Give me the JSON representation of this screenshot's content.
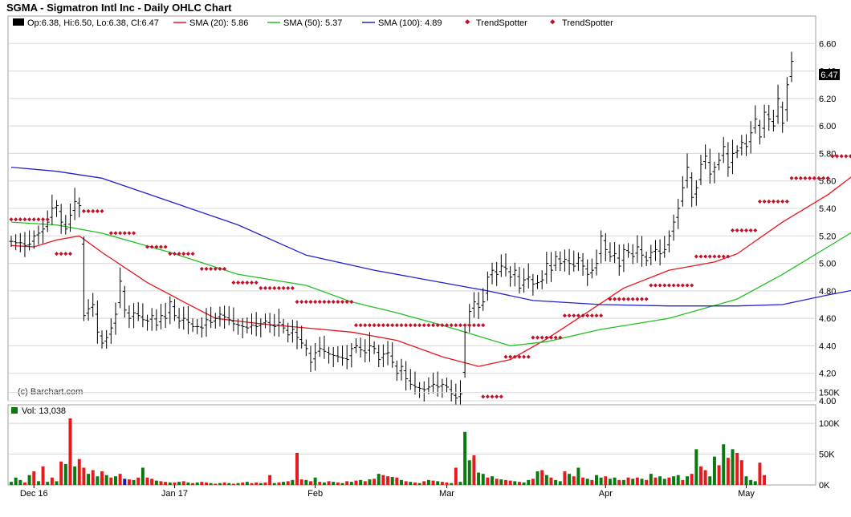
{
  "header": {
    "title": "SGMA - Sigmatron Intl Inc - Daily OHLC Chart"
  },
  "legend": {
    "ohlc": "Op:6.38, Hi:6.50, Lo:6.38, Cl:6.47",
    "sma20": "SMA (20): 5.86",
    "sma50": "SMA (50): 5.37",
    "sma100": "SMA (100): 4.89",
    "trend1": "TrendSpotter",
    "trend2": "TrendSpotter"
  },
  "watermark": "(c) Barchart.com",
  "last_price_label": "6.47",
  "volume_label": "Vol: 13,038",
  "colors": {
    "bar": "#000000",
    "sma20": "#e8141c",
    "sma50": "#22c022",
    "sma100": "#2020d0",
    "trendspotter": "#c0102a",
    "vol_up": "#0a7a10",
    "vol_down": "#e61a1a",
    "vol_flat": "#1a1a9a",
    "grid": "#d8d8d8"
  },
  "chart_data": [
    {
      "type": "ohlc",
      "title": "SGMA - Sigmatron Intl Inc - Daily OHLC Chart",
      "x_labels": [
        "Dec 16",
        "Jan 17",
        "Feb",
        "Mar",
        "Apr",
        "May"
      ],
      "x_label_index": [
        5,
        36,
        67,
        96,
        131,
        162
      ],
      "ylim": [
        4.0,
        6.8
      ],
      "y_ticks": [
        4.0,
        4.2,
        4.4,
        4.6,
        4.8,
        5.0,
        5.2,
        5.4,
        5.6,
        5.8,
        6.0,
        6.2,
        6.4,
        6.6
      ],
      "grid": true,
      "last": {
        "open": 6.38,
        "high": 6.5,
        "low": 6.38,
        "close": 6.47
      },
      "close": [
        5.16,
        5.15,
        5.15,
        5.13,
        5.14,
        5.2,
        5.22,
        5.25,
        5.3,
        5.4,
        5.42,
        5.3,
        5.25,
        5.35,
        5.45,
        5.42,
        4.62,
        4.67,
        4.7,
        4.5,
        4.42,
        4.46,
        4.53,
        4.63,
        4.87,
        4.66,
        4.6,
        4.64,
        4.62,
        4.59,
        4.58,
        4.62,
        4.55,
        4.62,
        4.6,
        4.72,
        4.62,
        4.58,
        4.6,
        4.57,
        4.54,
        4.54,
        4.53,
        4.59,
        4.57,
        4.6,
        4.63,
        4.61,
        4.59,
        4.56,
        4.55,
        4.54,
        4.53,
        4.55,
        4.54,
        4.56,
        4.58,
        4.55,
        4.54,
        4.57,
        4.53,
        4.48,
        4.52,
        4.46,
        4.42,
        4.38,
        4.28,
        4.35,
        4.38,
        4.36,
        4.34,
        4.33,
        4.32,
        4.31,
        4.3,
        4.38,
        4.4,
        4.37,
        4.35,
        4.4,
        4.38,
        4.3,
        4.34,
        4.35,
        4.28,
        4.2,
        4.25,
        4.16,
        4.12,
        4.1,
        4.09,
        4.08,
        4.1,
        4.12,
        4.1,
        4.12,
        4.1,
        4.05,
        4.02,
        4.05,
        4.5,
        4.65,
        4.72,
        4.68,
        4.72,
        4.9,
        4.95,
        4.92,
        4.98,
        4.96,
        4.9,
        4.95,
        4.82,
        4.88,
        4.9,
        4.85,
        4.86,
        4.88,
        5.0,
        4.95,
        5.05,
        5.0,
        5.03,
        5.0,
        4.98,
        5.04,
        4.98,
        4.92,
        4.95,
        5.0,
        5.2,
        5.1,
        5.05,
        5.07,
        4.98,
        5.1,
        5.08,
        5.05,
        5.12,
        5.06,
        5.02,
        5.08,
        5.1,
        5.07,
        5.1,
        5.2,
        5.3,
        5.4,
        5.55,
        5.7,
        5.48,
        5.55,
        5.72,
        5.78,
        5.65,
        5.7,
        5.75,
        5.85,
        5.7,
        5.8,
        5.82,
        5.88,
        5.85,
        5.95,
        6.05,
        5.92,
        6.1,
        6.05,
        6.0,
        6.2,
        6.02,
        6.3,
        6.47
      ],
      "sma": [
        {
          "name": "SMA (20)",
          "value": 5.86
        },
        {
          "name": "SMA (50)",
          "value": 5.37
        },
        {
          "name": "SMA (100)",
          "value": 4.89
        }
      ],
      "series": [
        {
          "name": "SMA (20)",
          "points": [
            [
              0,
              5.13
            ],
            [
              5,
              5.12
            ],
            [
              10,
              5.17
            ],
            [
              15,
              5.2
            ],
            [
              20,
              5.08
            ],
            [
              30,
              4.86
            ],
            [
              38,
              4.72
            ],
            [
              45,
              4.6
            ],
            [
              55,
              4.56
            ],
            [
              65,
              4.53
            ],
            [
              75,
              4.5
            ],
            [
              85,
              4.44
            ],
            [
              95,
              4.32
            ],
            [
              103,
              4.25
            ],
            [
              110,
              4.3
            ],
            [
              118,
              4.45
            ],
            [
              125,
              4.6
            ],
            [
              135,
              4.82
            ],
            [
              145,
              4.95
            ],
            [
              155,
              5.01
            ],
            [
              160,
              5.07
            ],
            [
              170,
              5.3
            ],
            [
              180,
              5.5
            ],
            [
              188,
              5.7
            ],
            [
              195,
              5.86
            ]
          ]
        },
        {
          "name": "SMA (50)",
          "points": [
            [
              0,
              5.3
            ],
            [
              10,
              5.28
            ],
            [
              20,
              5.22
            ],
            [
              35,
              5.08
            ],
            [
              50,
              4.92
            ],
            [
              65,
              4.84
            ],
            [
              75,
              4.72
            ],
            [
              85,
              4.64
            ],
            [
              95,
              4.55
            ],
            [
              103,
              4.47
            ],
            [
              110,
              4.4
            ],
            [
              118,
              4.43
            ],
            [
              130,
              4.52
            ],
            [
              145,
              4.6
            ],
            [
              160,
              4.74
            ],
            [
              170,
              4.92
            ],
            [
              180,
              5.12
            ],
            [
              188,
              5.28
            ],
            [
              195,
              5.37
            ]
          ]
        },
        {
          "name": "SMA (100)",
          "points": [
            [
              0,
              5.7
            ],
            [
              10,
              5.67
            ],
            [
              20,
              5.62
            ],
            [
              35,
              5.45
            ],
            [
              50,
              5.28
            ],
            [
              65,
              5.06
            ],
            [
              80,
              4.95
            ],
            [
              95,
              4.86
            ],
            [
              105,
              4.8
            ],
            [
              115,
              4.73
            ],
            [
              130,
              4.7
            ],
            [
              145,
              4.69
            ],
            [
              160,
              4.69
            ],
            [
              170,
              4.7
            ],
            [
              180,
              4.77
            ],
            [
              188,
              4.82
            ],
            [
              195,
              4.89
            ]
          ]
        }
      ],
      "trendspotter": [
        {
          "name": "TrendSpotter",
          "from": 0,
          "to": 8,
          "level": 5.32
        },
        {
          "name": "TrendSpotter",
          "from": 10,
          "to": 13,
          "level": 5.07
        },
        {
          "name": "TrendSpotter",
          "from": 16,
          "to": 20,
          "level": 5.38
        },
        {
          "name": "TrendSpotter",
          "from": 22,
          "to": 27,
          "level": 5.22
        },
        {
          "name": "TrendSpotter",
          "from": 30,
          "to": 34,
          "level": 5.12
        },
        {
          "name": "TrendSpotter",
          "from": 35,
          "to": 40,
          "level": 5.07
        },
        {
          "name": "TrendSpotter",
          "from": 42,
          "to": 47,
          "level": 4.96
        },
        {
          "name": "TrendSpotter",
          "from": 49,
          "to": 54,
          "level": 4.86
        },
        {
          "name": "TrendSpotter",
          "from": 55,
          "to": 62,
          "level": 4.82
        },
        {
          "name": "TrendSpotter",
          "from": 63,
          "to": 75,
          "level": 4.72
        },
        {
          "name": "TrendSpotter",
          "from": 76,
          "to": 104,
          "level": 4.55
        },
        {
          "name": "TrendSpotter",
          "from": 104,
          "to": 108,
          "level": 4.03
        },
        {
          "name": "TrendSpotter",
          "from": 109,
          "to": 114,
          "level": 4.32
        },
        {
          "name": "TrendSpotter",
          "from": 115,
          "to": 121,
          "level": 4.46
        },
        {
          "name": "TrendSpotter",
          "from": 122,
          "to": 130,
          "level": 4.62
        },
        {
          "name": "TrendSpotter",
          "from": 132,
          "to": 140,
          "level": 4.74
        },
        {
          "name": "TrendSpotter",
          "from": 141,
          "to": 150,
          "level": 4.84
        },
        {
          "name": "TrendSpotter",
          "from": 151,
          "to": 158,
          "level": 5.05
        },
        {
          "name": "TrendSpotter",
          "from": 159,
          "to": 164,
          "level": 5.24
        },
        {
          "name": "TrendSpotter",
          "from": 165,
          "to": 171,
          "level": 5.45
        },
        {
          "name": "TrendSpotter",
          "from": 172,
          "to": 180,
          "level": 5.62
        },
        {
          "name": "TrendSpotter",
          "from": 181,
          "to": 186,
          "level": 5.78
        },
        {
          "name": "TrendSpotter",
          "from": 187,
          "to": 195,
          "level": 5.98
        }
      ]
    },
    {
      "type": "bar",
      "title": "Vol: 13,038",
      "ylim": [
        0,
        130000
      ],
      "y_tick_labels": [
        "0K",
        "50K",
        "100K",
        "150K"
      ],
      "y_tick_values": [
        0,
        50000,
        100000,
        150000
      ],
      "volume": [
        5000,
        12000,
        8000,
        4000,
        16000,
        22000,
        6000,
        30000,
        5000,
        12000,
        6000,
        38000,
        34000,
        108000,
        30000,
        42000,
        28000,
        18000,
        24000,
        14000,
        22000,
        16000,
        12000,
        14000,
        18000,
        10000,
        9000,
        8000,
        12000,
        28000,
        12000,
        10000,
        7000,
        6000,
        5000,
        4000,
        4000,
        5000,
        6000,
        4000,
        3000,
        4000,
        5000,
        4000,
        3000,
        2000,
        3000,
        4000,
        3000,
        2000,
        3000,
        4000,
        5000,
        3000,
        4000,
        3000,
        4000,
        16000,
        3000,
        4000,
        5000,
        6000,
        8000,
        52000,
        9000,
        8000,
        6000,
        12000,
        5000,
        4000,
        6000,
        5000,
        4000,
        3000,
        6000,
        5000,
        7000,
        8000,
        6000,
        9000,
        10000,
        18000,
        16000,
        14000,
        13000,
        12000,
        8000,
        6000,
        5000,
        4000,
        3000,
        6000,
        8000,
        7000,
        6000,
        5000,
        4000,
        3000,
        28000,
        5000,
        86000,
        40000,
        48000,
        20000,
        18000,
        12000,
        14000,
        10000,
        9000,
        8000,
        7000,
        6000,
        5000,
        4000,
        8000,
        10000,
        22000,
        24000,
        16000,
        12000,
        8000,
        6000,
        22000,
        18000,
        14000,
        28000,
        12000,
        10000,
        8000,
        16000,
        12000,
        14000,
        10000,
        12000,
        8000,
        8000,
        12000,
        10000,
        12000,
        10000,
        8000,
        18000,
        12000,
        14000,
        10000,
        12000,
        14000,
        16000,
        8000,
        14000,
        18000,
        58000,
        30000,
        24000,
        14000,
        46000,
        32000,
        66000,
        44000,
        58000,
        52000,
        40000,
        14000,
        8000,
        6000,
        36000,
        16000
      ],
      "vol_dir": [
        1,
        1,
        1,
        0,
        1,
        0,
        1,
        0,
        1,
        0,
        1,
        0,
        1,
        0,
        1,
        0,
        0,
        1,
        0,
        1,
        0,
        1,
        0,
        1,
        0,
        2,
        0,
        1,
        0,
        1,
        0,
        0,
        1,
        0,
        0,
        1,
        0,
        1,
        0,
        1,
        0,
        1,
        0,
        0,
        1,
        0,
        1,
        0,
        1,
        0,
        1,
        0,
        1,
        0,
        0,
        1,
        0,
        0,
        1,
        0,
        1,
        0,
        1,
        0,
        0,
        1,
        0,
        1,
        0,
        1,
        0,
        1,
        0,
        1,
        0,
        1,
        0,
        1,
        0,
        1,
        0,
        1,
        0,
        0,
        1,
        0,
        1,
        0,
        1,
        0,
        1,
        0,
        1,
        0,
        1,
        0,
        0,
        1,
        0,
        1,
        1,
        1,
        0,
        1,
        1,
        0,
        1,
        0,
        1,
        0,
        0,
        1,
        0,
        1,
        1,
        0,
        1,
        0,
        1,
        0,
        1,
        1,
        0,
        1,
        0,
        1,
        0,
        1,
        0,
        1,
        1,
        0,
        1,
        1,
        0,
        1,
        0,
        1,
        0,
        1,
        0,
        1,
        0,
        1,
        1,
        0,
        1,
        1,
        0,
        1,
        0,
        1,
        0,
        0,
        1,
        1,
        0,
        1,
        0,
        1,
        0,
        0,
        1,
        1,
        1
      ]
    }
  ]
}
